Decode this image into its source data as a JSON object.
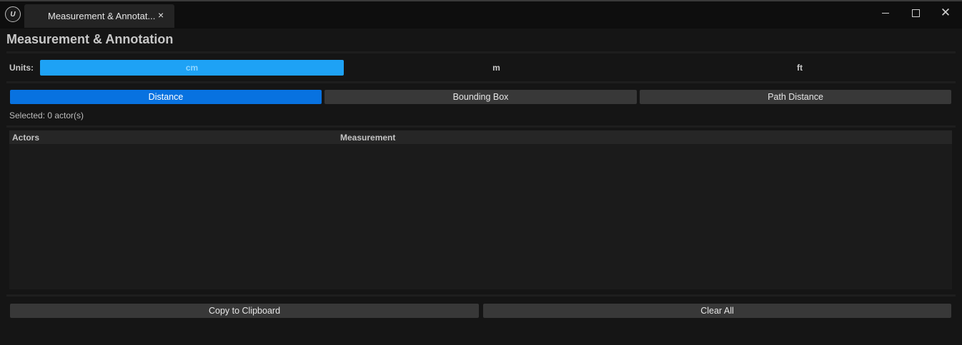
{
  "titlebar": {
    "logo_text": "U",
    "tab_label": "Measurement & Annotat...",
    "tab_close": "×",
    "close_glyph": "✕"
  },
  "panel": {
    "title": "Measurement & Annotation"
  },
  "units": {
    "label": "Units:",
    "options": [
      {
        "label": "cm",
        "active": true
      },
      {
        "label": "m",
        "active": false
      },
      {
        "label": "ft",
        "active": false
      }
    ],
    "active_color": "#1ea2f5"
  },
  "modes": [
    {
      "label": "Distance",
      "active": true
    },
    {
      "label": "Bounding Box",
      "active": false
    },
    {
      "label": "Path Distance",
      "active": false
    }
  ],
  "selection": {
    "text": "Selected: 0 actor(s)"
  },
  "table": {
    "columns": [
      "Actors",
      "Measurement"
    ],
    "rows": []
  },
  "actions": {
    "copy_label": "Copy to Clipboard",
    "clear_label": "Clear All"
  },
  "colors": {
    "accent_blue": "#0872e0",
    "background": "#151515"
  }
}
